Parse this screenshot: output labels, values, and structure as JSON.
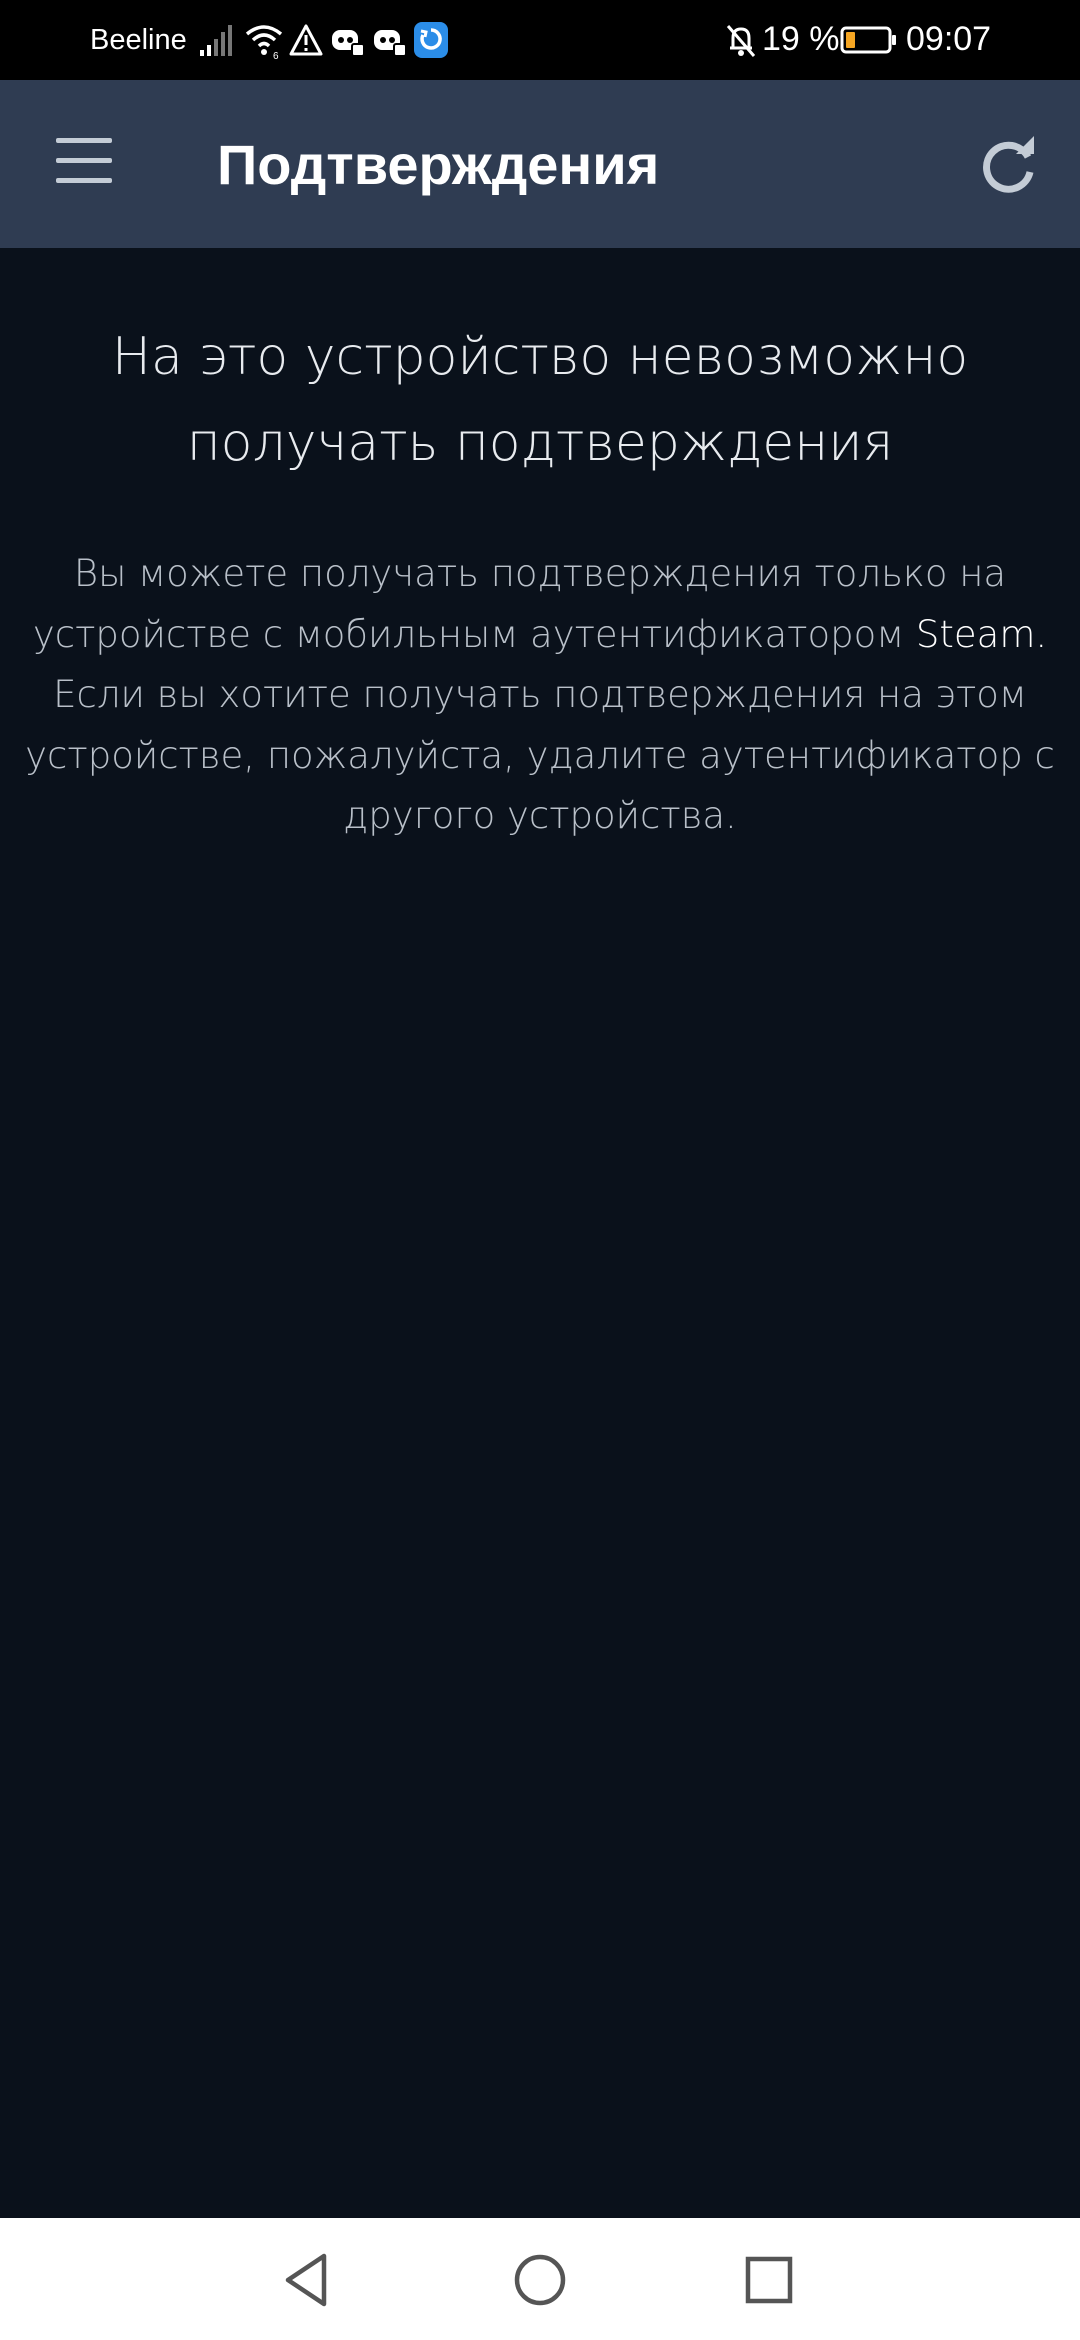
{
  "status_bar": {
    "carrier": "Beeline",
    "battery_percent": "19 %",
    "time": "09:07",
    "battery_level": 0.19,
    "icons": [
      "signal-icon",
      "wifi-icon",
      "warning-icon",
      "discord-icon",
      "discord-icon",
      "app-notification-icon",
      "bell-off-icon",
      "battery-icon"
    ]
  },
  "app_bar": {
    "title": "Подтверждения",
    "menu_icon": "menu-icon",
    "refresh_icon": "refresh-icon"
  },
  "main": {
    "heading_lines": [
      "На это устройство невозможно",
      "получать подтверждения"
    ],
    "description": {
      "line1": "Вы можете получать подтверждения только на",
      "line2_prefix": "устройстве с мобильным аутентификатором ",
      "line2_brand": "Steam",
      "line2_suffix": ".",
      "line3": "Если вы хотите получать подтверждения на этом",
      "line4": "устройстве, пожалуйста, удалите аутентификатор с",
      "line5": "другого устройства."
    }
  },
  "nav_bar": {
    "icons": [
      "back-icon",
      "home-icon",
      "recents-icon"
    ]
  },
  "colors": {
    "status_bar_bg": "#000000",
    "app_bar_bg": "#2f3c52",
    "content_bg": "#0a111b",
    "nav_bar_bg": "#ffffff",
    "battery_low": "#f5a623"
  }
}
